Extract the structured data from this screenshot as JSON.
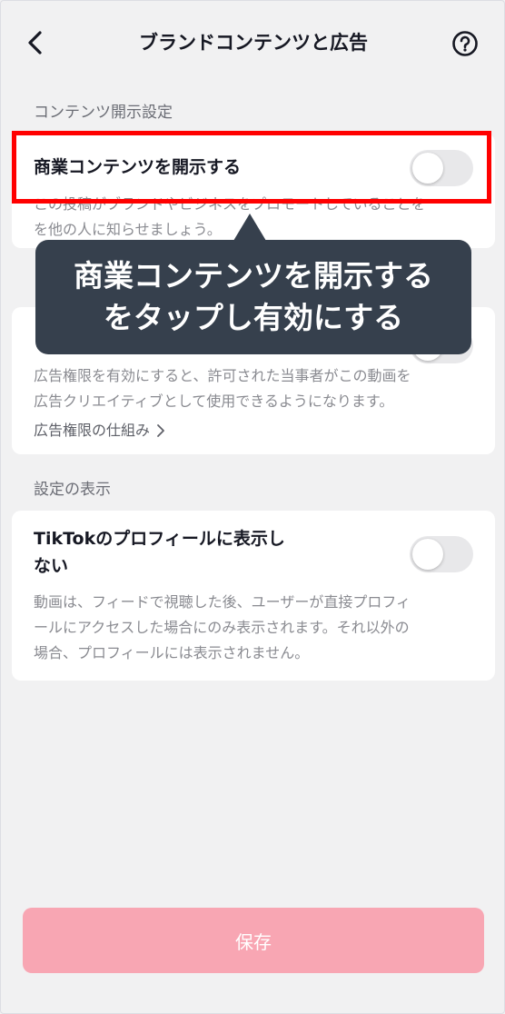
{
  "header": {
    "title": "ブランドコンテンツと広告",
    "back_icon": "chevron-left-icon",
    "help_icon": "question-circle-icon"
  },
  "sections": {
    "content_disclosure_label": "コンテンツ開示設定",
    "display_label": "設定の表示"
  },
  "disclosure_card": {
    "title": "商業コンテンツを開示する",
    "toggle_on": false,
    "desc_line1": "この投稿がブランドやビジネスをプロモートしていることを",
    "desc_line2": "を他の人に知らせましょう。"
  },
  "ad_card": {
    "desc_line1": "広告権限を有効にすると、許可された当事者がこの動画を",
    "desc_line2": "広告クリエイティブとして使用できるようになります。",
    "link_label": "広告権限の仕組み"
  },
  "profile_card": {
    "title_line1": "TikTokのプロフィールに表示し",
    "title_line2": "ない",
    "toggle_on": false,
    "desc_line1": "動画は、フィードで視聴した後、ユーザーが直接プロフィ",
    "desc_line2": "ールにアクセスした場合にのみ表示されます。それ以外の",
    "desc_line3": "場合、プロフィールには表示されません。"
  },
  "tooltip": {
    "line1": "商業コンテンツを開示する",
    "line2": "をタップし有効にする"
  },
  "save_button": {
    "label": "保存"
  },
  "colors": {
    "highlight": "#ff0000",
    "tooltip_bg": "#36404d",
    "save_button_bg": "#f8a6b3",
    "page_bg": "#f1f1f2"
  }
}
